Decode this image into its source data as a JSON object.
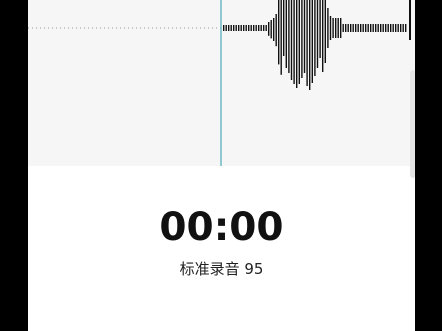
{
  "recorder": {
    "elapsed_time": "00:00",
    "recording_name": "标准录音 95"
  },
  "colors": {
    "background": "#f6f6f6",
    "playhead": "#6fb8c6",
    "waveform": "#111111",
    "dotted_baseline": "#9a9a9a"
  }
}
